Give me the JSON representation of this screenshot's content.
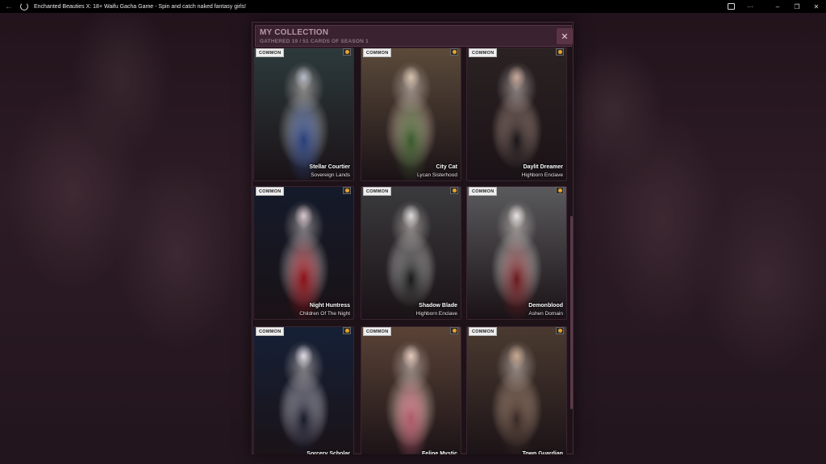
{
  "window": {
    "title": "Enchanted Beauties X: 18+ Waifu Gacha Game - Spin and catch naked fantasy girls!",
    "back_icon": "←",
    "minimize_icon": "–",
    "maximize_icon": "❐",
    "close_icon": "✕",
    "more_icon": "···"
  },
  "panel": {
    "title": "MY COLLECTION",
    "subtitle": "GATHERED 19 / 51 CARDS OF SEASON 1",
    "close_label": "✕"
  },
  "cards": [
    {
      "rarity": "COMMON",
      "name": "Stellar Courtier",
      "origin": "Sovereign Lands",
      "palette": [
        "#2c3a3c",
        "#b7bcc7",
        "#2a3f7a"
      ]
    },
    {
      "rarity": "COMMON",
      "name": "City Cat",
      "origin": "Lycan Sisterhood",
      "palette": [
        "#5b4a3a",
        "#d6c3ad",
        "#3b5a2e"
      ]
    },
    {
      "rarity": "COMMON",
      "name": "Daylit Dreamer",
      "origin": "Highborn Enclave",
      "palette": [
        "#2a2222",
        "#c9a89a",
        "#1a1518"
      ]
    },
    {
      "rarity": "COMMON",
      "name": "Night Huntress",
      "origin": "Children Of The Night",
      "palette": [
        "#141a2a",
        "#d8c8cc",
        "#8a1218"
      ]
    },
    {
      "rarity": "COMMON",
      "name": "Shadow Blade",
      "origin": "Highborn Enclave",
      "palette": [
        "#3a3a3c",
        "#dcdadb",
        "#1a1a1a"
      ]
    },
    {
      "rarity": "COMMON",
      "name": "Demonblood",
      "origin": "Ashen Domain",
      "palette": [
        "#5a5a5c",
        "#e8e2e0",
        "#6a1a1e"
      ]
    },
    {
      "rarity": "COMMON",
      "name": "Sorcery Scholar",
      "origin": "",
      "palette": [
        "#152036",
        "#e0dde6",
        "#1a1a2a"
      ]
    },
    {
      "rarity": "COMMON",
      "name": "Feline Mystic",
      "origin": "",
      "palette": [
        "#5a4236",
        "#e6c9bc",
        "#b05a6a"
      ]
    },
    {
      "rarity": "COMMON",
      "name": "Town Guardian",
      "origin": "",
      "palette": [
        "#4a3a30",
        "#c7a890",
        "#3a2a26"
      ]
    }
  ]
}
